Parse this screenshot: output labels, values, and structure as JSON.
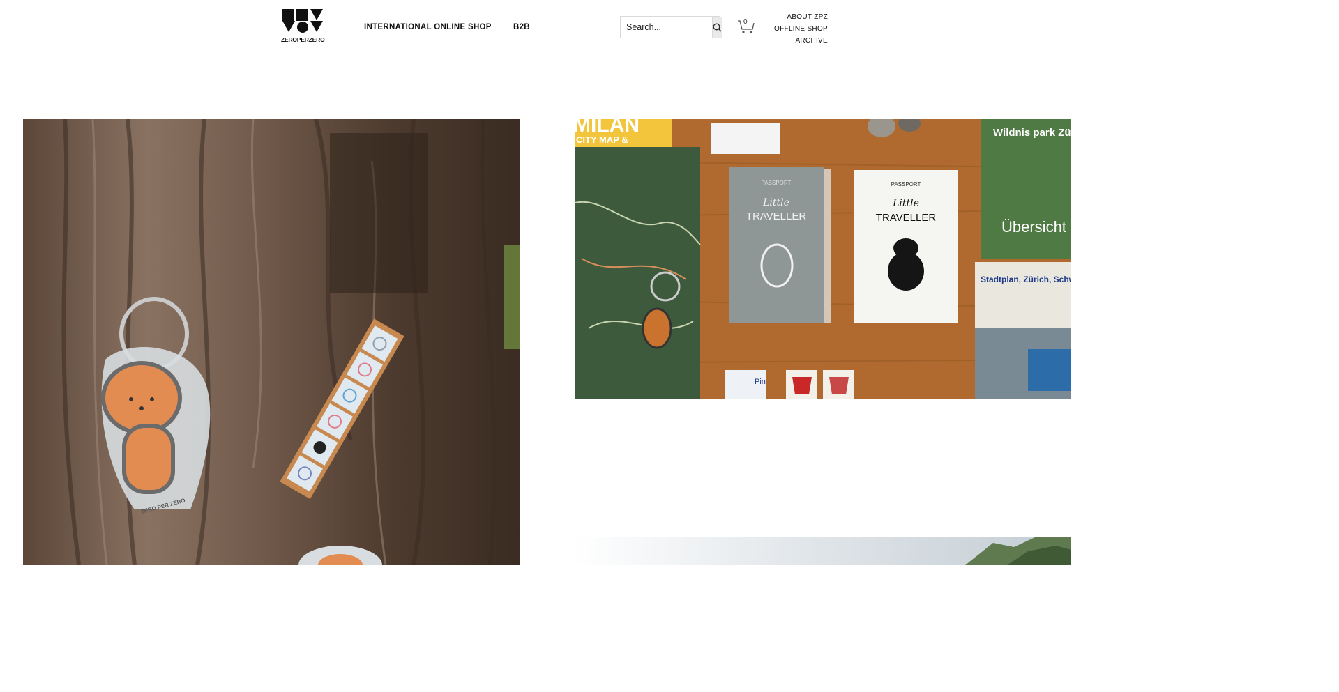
{
  "header": {
    "logo": {
      "wordmark": "ZEROPERZERO",
      "icon": "zpz-logo-icon"
    },
    "nav": {
      "shop_label": "INTERNATIONAL ONLINE SHOP",
      "b2b_label": "B2B"
    },
    "search": {
      "placeholder": "Search...",
      "value": "",
      "icon": "search-icon"
    },
    "cart": {
      "count": "0",
      "icon": "cart-icon"
    },
    "right_menu": [
      "ABOUT ZPZ",
      "OFFLINE SHOP",
      "ARCHIVE"
    ]
  },
  "gallery": {
    "tile_1": {
      "subject": "poodle-keychain-photo",
      "printed_text": "ZERO PER ZERO"
    },
    "tile_2": {
      "subject": "little-traveller-passports-photo",
      "printed_text": [
        "PASSPORT",
        "Little",
        "TRAVELLER",
        "PASSPORT",
        "Little",
        "TRAVELLER",
        "Wildnis park Zürich",
        "Übersicht",
        "Stadtplan, Zürich, Schweiz.",
        "CITY MAP &",
        "MILAN",
        "Pin"
      ]
    },
    "tile_3": {
      "subject": "mountain-landscape-photo"
    }
  },
  "colors": {
    "text": "#111111",
    "search_button_bg": "#e9e9e9",
    "border": "#d9d9d9",
    "background": "#ffffff"
  }
}
